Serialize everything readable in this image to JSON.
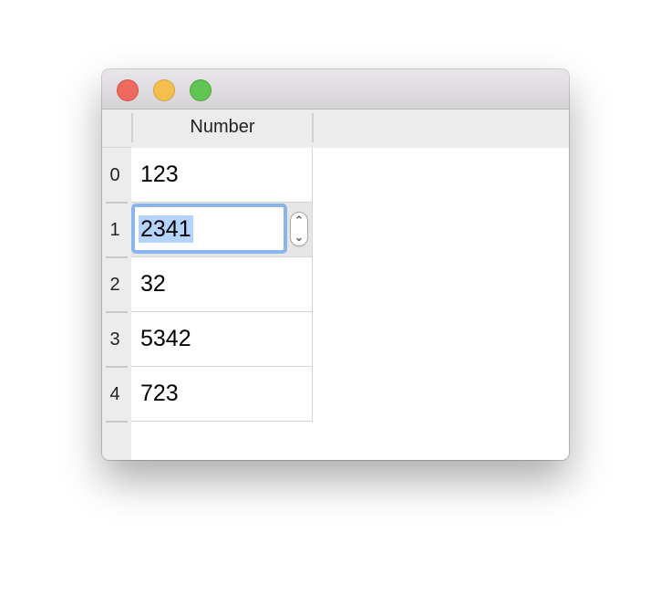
{
  "window": {
    "controls": [
      "close-button",
      "minimize-button",
      "zoom-button"
    ]
  },
  "table": {
    "column_header": "Number",
    "rows": [
      {
        "index": "0",
        "value": "123"
      },
      {
        "index": "1",
        "value": "2341"
      },
      {
        "index": "2",
        "value": "32"
      },
      {
        "index": "3",
        "value": "5342"
      },
      {
        "index": "4",
        "value": "723"
      }
    ],
    "editing_row": 1,
    "editor_value": "2341"
  },
  "icons": {
    "stepper_up": "chevron-up-icon",
    "stepper_down": "chevron-down-icon"
  },
  "colors": {
    "close": "#ed6a5e",
    "minimize": "#f5bf4f",
    "zoom": "#61c554",
    "focus_ring": "#8ab4ec",
    "selection": "#b5d4fc"
  }
}
